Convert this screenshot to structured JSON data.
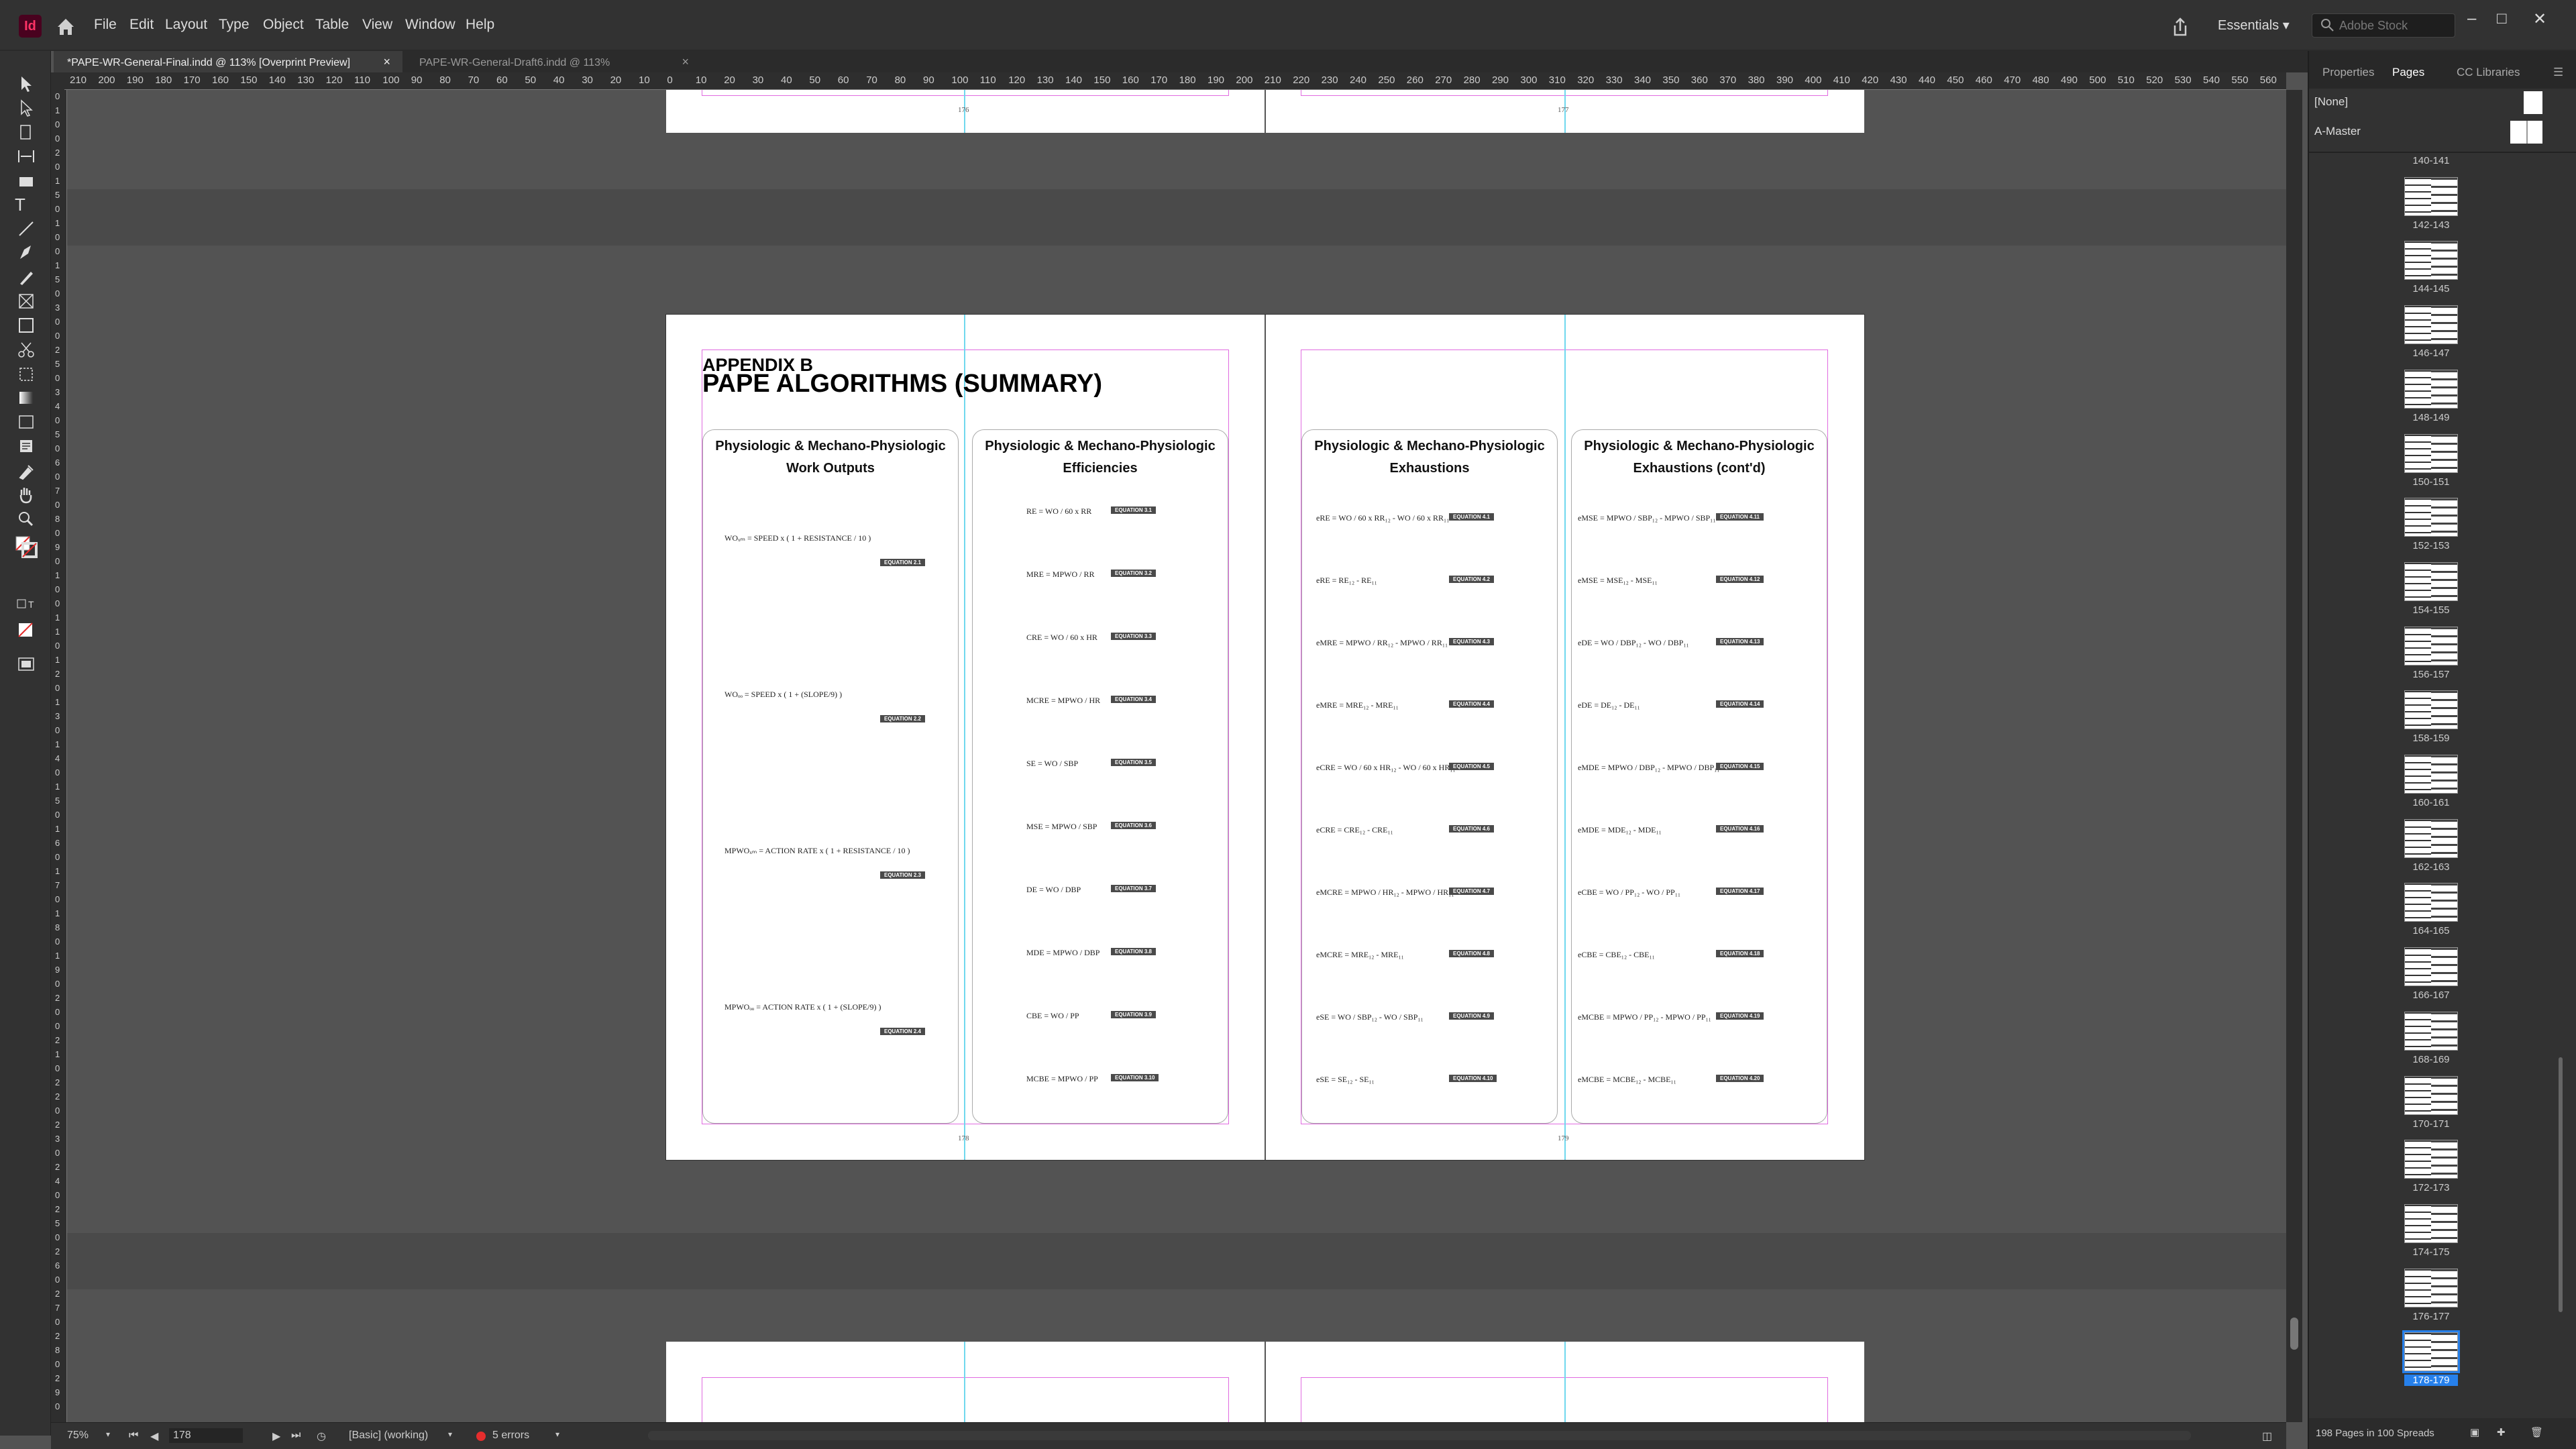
{
  "app": {
    "logo": "Id",
    "home_icon": "home-icon"
  },
  "menu": [
    "File",
    "Edit",
    "Layout",
    "Type",
    "Object",
    "Table",
    "View",
    "Window",
    "Help"
  ],
  "workspace": {
    "label": "Essentials",
    "search_placeholder": "Adobe Stock"
  },
  "window_buttons": {
    "min": "–",
    "max": "□",
    "close": "✕"
  },
  "tabs": [
    {
      "label": "*PAPE-WR-General-Final.indd @ 113% [Overprint Preview]",
      "close": "×"
    },
    {
      "label": "PAPE-WR-General-Draft6.indd @ 113%",
      "close": "×"
    }
  ],
  "hruler_ticks": [
    "210",
    "200",
    "190",
    "180",
    "170",
    "160",
    "150",
    "140",
    "130",
    "120",
    "110",
    "100",
    "90",
    "80",
    "70",
    "60",
    "50",
    "40",
    "30",
    "20",
    "10",
    "0",
    "10",
    "20",
    "30",
    "40",
    "50",
    "60",
    "70",
    "80",
    "90",
    "100",
    "110",
    "120",
    "130",
    "140",
    "150",
    "160",
    "170",
    "180",
    "190",
    "200",
    "210",
    "220",
    "230",
    "240",
    "250",
    "260",
    "270",
    "280",
    "290",
    "300",
    "310",
    "320",
    "330",
    "340",
    "350",
    "360",
    "370",
    "380",
    "390",
    "400",
    "410",
    "420",
    "430",
    "440",
    "450",
    "460",
    "470",
    "480",
    "490",
    "500",
    "510",
    "520",
    "530",
    "540",
    "550",
    "560"
  ],
  "vruler_ticks": [
    "0",
    "1",
    "0",
    "0",
    "2",
    "0",
    "1",
    "5",
    "0",
    "1",
    "0",
    "0",
    "1",
    "5",
    "0",
    "3",
    "0",
    "0",
    "2",
    "5",
    "0",
    "3",
    "4",
    "0",
    "5",
    "0",
    "6",
    "0",
    "7",
    "0",
    "8",
    "0",
    "9",
    "0",
    "1",
    "0",
    "0",
    "1",
    "1",
    "0",
    "1",
    "2",
    "0",
    "1",
    "3",
    "0",
    "1",
    "4",
    "0",
    "1",
    "5",
    "0",
    "1",
    "6",
    "0",
    "1",
    "7",
    "0",
    "1",
    "8",
    "0",
    "1",
    "9",
    "0",
    "2",
    "0",
    "0",
    "2",
    "1",
    "0",
    "2",
    "2",
    "0",
    "2",
    "3",
    "0",
    "2",
    "4",
    "0",
    "2",
    "5",
    "0",
    "2",
    "6",
    "0",
    "2",
    "7",
    "0",
    "2",
    "8",
    "0",
    "2",
    "9",
    "0"
  ],
  "spread_top": {
    "left_page_number": "176",
    "right_page_number": "177"
  },
  "spread_main": {
    "appendix": "APPENDIX B",
    "title": "PAPE ALGORITHMS (SUMMARY)",
    "left_page_number": "178",
    "right_page_number": "179",
    "columns": [
      {
        "title1": "Physiologic & Mechano-Physiologic",
        "title2": "Work Outputs"
      },
      {
        "title1": "Physiologic & Mechano-Physiologic",
        "title2": "Efficiencies"
      },
      {
        "title1": "Physiologic & Mechano-Physiologic",
        "title2": "Exhaustions"
      },
      {
        "title1": "Physiologic & Mechano-Physiologic",
        "title2": "Exhaustions (cont'd)"
      }
    ],
    "col1": [
      {
        "eq": "WOₓₘ = SPEED x ( 1 + RESISTANCE / 10 )",
        "tag": "EQUATION 2.1"
      },
      {
        "eq": "WOₒₒ = SPEED x ( 1 + (SLOPE/9) )",
        "tag": "EQUATION 2.2"
      },
      {
        "eq": "MPWOₓₘ = ACTION RATE x ( 1 + RESISTANCE / 10 )",
        "tag": "EQUATION 2.3"
      },
      {
        "eq": "MPWOₒₒ = ACTION RATE x ( 1 + (SLOPE/9) )",
        "tag": "EQUATION 2.4"
      }
    ],
    "col2": [
      {
        "eq": "RE = WO / 60 x RR",
        "tag": "EQUATION 3.1"
      },
      {
        "eq": "MRE = MPWO / RR",
        "tag": "EQUATION 3.2"
      },
      {
        "eq": "CRE = WO / 60 x HR",
        "tag": "EQUATION 3.3"
      },
      {
        "eq": "MCRE = MPWO / HR",
        "tag": "EQUATION 3.4"
      },
      {
        "eq": "SE = WO / SBP",
        "tag": "EQUATION 3.5"
      },
      {
        "eq": "MSE = MPWO / SBP",
        "tag": "EQUATION 3.6"
      },
      {
        "eq": "DE = WO / DBP",
        "tag": "EQUATION 3.7"
      },
      {
        "eq": "MDE = MPWO / DBP",
        "tag": "EQUATION 3.8"
      },
      {
        "eq": "CBE = WO / PP",
        "tag": "EQUATION 3.9"
      },
      {
        "eq": "MCBE = MPWO / PP",
        "tag": "EQUATION 3.10"
      }
    ],
    "col3": [
      {
        "eq": "eRE = WO / 60 x RR₁₂ - WO / 60 x RR₁₁",
        "tag": "EQUATION 4.1"
      },
      {
        "eq": "eRE = RE₁₂ - RE₁₁",
        "tag": "EQUATION 4.2"
      },
      {
        "eq": "eMRE = MPWO / RR₁₂ - MPWO / RR₁₁",
        "tag": "EQUATION 4.3"
      },
      {
        "eq": "eMRE = MRE₁₂ - MRE₁₁",
        "tag": "EQUATION 4.4"
      },
      {
        "eq": "eCRE = WO / 60 x HR₁₂ - WO / 60 x HR₁₁",
        "tag": "EQUATION 4.5"
      },
      {
        "eq": "eCRE = CRE₁₂ - CRE₁₁",
        "tag": "EQUATION 4.6"
      },
      {
        "eq": "eMCRE = MPWO / HR₁₂ - MPWO / HR₁₁",
        "tag": "EQUATION 4.7"
      },
      {
        "eq": "eMCRE = MRE₁₂ - MRE₁₁",
        "tag": "EQUATION 4.8"
      },
      {
        "eq": "eSE = WO / SBP₁₂ - WO / SBP₁₁",
        "tag": "EQUATION 4.9"
      },
      {
        "eq": "eSE = SE₁₂ - SE₁₁",
        "tag": "EQUATION 4.10"
      }
    ],
    "col4": [
      {
        "eq": "eMSE = MPWO / SBP₁₂ - MPWO / SBP₁₁",
        "tag": "EQUATION 4.11"
      },
      {
        "eq": "eMSE = MSE₁₂ - MSE₁₁",
        "tag": "EQUATION 4.12"
      },
      {
        "eq": "eDE = WO / DBP₁₂ - WO / DBP₁₁",
        "tag": "EQUATION 4.13"
      },
      {
        "eq": "eDE = DE₁₂ - DE₁₁",
        "tag": "EQUATION 4.14"
      },
      {
        "eq": "eMDE = MPWO / DBP₁₂ - MPWO / DBP₁₁",
        "tag": "EQUATION 4.15"
      },
      {
        "eq": "eMDE = MDE₁₂ - MDE₁₁",
        "tag": "EQUATION 4.16"
      },
      {
        "eq": "eCBE = WO / PP₁₂ - WO / PP₁₁",
        "tag": "EQUATION 4.17"
      },
      {
        "eq": "eCBE = CBE₁₂ - CBE₁₁",
        "tag": "EQUATION 4.18"
      },
      {
        "eq": "eMCBE = MPWO / PP₁₂ - MPWO / PP₁₁",
        "tag": "EQUATION 4.19"
      },
      {
        "eq": "eMCBE = MCBE₁₂ - MCBE₁₁",
        "tag": "EQUATION 4.20"
      }
    ]
  },
  "status": {
    "zoom": "75%",
    "page": "178",
    "preflight_profile": "[Basic] (working)",
    "errors": "5 errors"
  },
  "panel": {
    "tabs": [
      "Properties",
      "Pages",
      "CC Libraries"
    ],
    "masters": [
      "[None]",
      "A-Master"
    ],
    "spreads": [
      "140-141",
      "142-143",
      "144-145",
      "146-147",
      "148-149",
      "150-151",
      "152-153",
      "154-155",
      "156-157",
      "158-159",
      "160-161",
      "162-163",
      "164-165",
      "166-167",
      "168-169",
      "170-171",
      "172-173",
      "174-175",
      "176-177",
      "178-179"
    ],
    "selected_spread": "178-179",
    "footer": "198 Pages in 100 Spreads"
  },
  "colors": {
    "accent": "#2680eb",
    "margin": "#e06be0",
    "guide": "#70d8ee",
    "error": "#e52d2d",
    "tag_bg": "#4a4a4a"
  }
}
